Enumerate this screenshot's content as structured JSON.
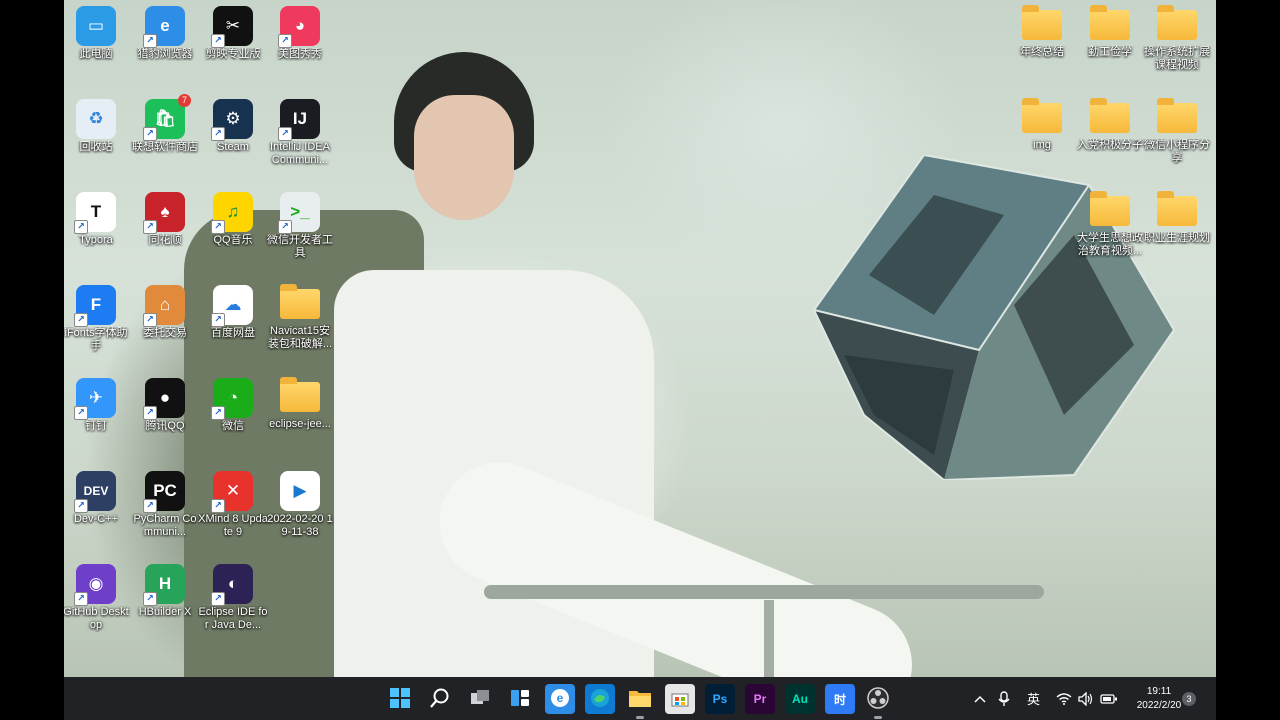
{
  "desktop": {
    "left_icons": [
      {
        "id": "this-pc",
        "label": "此电脑",
        "icon": "monitor-icon",
        "color": "#2b9be8",
        "shortcut": false
      },
      {
        "id": "browser",
        "label": "猎豹浏览器",
        "icon": "browser-icon",
        "color": "#2e8de6",
        "shortcut": true
      },
      {
        "id": "capcut",
        "label": "剪映专业版",
        "icon": "capcut-icon",
        "color": "#111111",
        "shortcut": true
      },
      {
        "id": "meitu",
        "label": "美图秀秀",
        "icon": "meitu-icon",
        "color": "#ef3a5d",
        "shortcut": true
      },
      {
        "id": "recycle-bin",
        "label": "回收站",
        "icon": "recycle-bin-icon",
        "color": "#e6eef5",
        "shortcut": false
      },
      {
        "id": "lenovo-store",
        "label": "联想软件商店",
        "icon": "shopping-bag-icon",
        "color": "#1dbf5a",
        "shortcut": true,
        "badge": "7"
      },
      {
        "id": "steam",
        "label": "Steam",
        "icon": "steam-icon",
        "color": "#16324f",
        "shortcut": true
      },
      {
        "id": "intellij",
        "label": "IntelliJ IDEA Communi...",
        "icon": "intellij-icon",
        "color": "#1b1b22",
        "shortcut": true
      },
      {
        "id": "typora",
        "label": "Typora",
        "icon": "typora-icon",
        "color": "#ffffff",
        "shortcut": true
      },
      {
        "id": "tonghuashun",
        "label": "同花顺",
        "icon": "cards-icon",
        "color": "#c8222a",
        "shortcut": true
      },
      {
        "id": "qq-music",
        "label": "QQ音乐",
        "icon": "music-icon",
        "color": "#ffd500",
        "shortcut": true
      },
      {
        "id": "wechat-devtools",
        "label": "微信开发者工具",
        "icon": "terminal-icon",
        "color": "#e8eef0",
        "shortcut": true
      },
      {
        "id": "ifonts",
        "label": "iFonts字体助手",
        "icon": "ifonts-icon",
        "color": "#1d7cf2",
        "shortcut": true
      },
      {
        "id": "weituo",
        "label": "委托交易",
        "icon": "house-icon",
        "color": "#e28a3b",
        "shortcut": true
      },
      {
        "id": "baidu-pan",
        "label": "百度网盘",
        "icon": "cloud-icon",
        "color": "#ffffff",
        "shortcut": true
      },
      {
        "id": "navicat",
        "label": "Navicat15安装包和破解...",
        "icon": "folder-icon",
        "color": "#f6b93b",
        "shortcut": false
      },
      {
        "id": "dingtalk",
        "label": "钉钉",
        "icon": "dingtalk-icon",
        "color": "#3296fa",
        "shortcut": true
      },
      {
        "id": "qq",
        "label": "腾讯QQ",
        "icon": "penguin-icon",
        "color": "#111111",
        "shortcut": true
      },
      {
        "id": "wechat",
        "label": "微信",
        "icon": "wechat-icon",
        "color": "#1aad19",
        "shortcut": true
      },
      {
        "id": "eclipse-folder",
        "label": "eclipse-jee...",
        "icon": "folder-icon",
        "color": "#f6b93b",
        "shortcut": false
      },
      {
        "id": "devcpp",
        "label": "Dev-C++",
        "icon": "dev-icon",
        "color": "#2d3f63",
        "shortcut": true
      },
      {
        "id": "pycharm",
        "label": "PyCharm Communi...",
        "icon": "pycharm-icon",
        "color": "#111111",
        "shortcut": true
      },
      {
        "id": "xmind",
        "label": "XMind 8 Update 9",
        "icon": "xmind-icon",
        "color": "#e8322c",
        "shortcut": true
      },
      {
        "id": "video-file",
        "label": "2022-02-20 19-11-38",
        "icon": "video-file-icon",
        "color": "#ffffff",
        "shortcut": false
      },
      {
        "id": "github-desktop",
        "label": "GitHub Desktop",
        "icon": "github-icon",
        "color": "#6e40c9",
        "shortcut": true
      },
      {
        "id": "hbuilder",
        "label": "HBuilder X",
        "icon": "hbuilder-icon",
        "color": "#27a35a",
        "shortcut": true
      },
      {
        "id": "eclipse",
        "label": "Eclipse IDE for Java De...",
        "icon": "eclipse-icon",
        "color": "#2c2255",
        "shortcut": true
      }
    ],
    "right_folders": [
      {
        "id": "annual-summary",
        "label": "年终总结"
      },
      {
        "id": "work-study",
        "label": "勤工俭学"
      },
      {
        "id": "os-course",
        "label": "操作系统扩展课程视频"
      },
      {
        "id": "img",
        "label": "img"
      },
      {
        "id": "party-member",
        "label": "入党积极分子"
      },
      {
        "id": "mini-program",
        "label": "微信小程序分享"
      },
      {
        "id": "ideology",
        "label": "大学生思想政治教育视频..."
      },
      {
        "id": "career",
        "label": "职业生涯规划"
      }
    ]
  },
  "taskbar": {
    "apps": [
      {
        "id": "start",
        "icon": "windows-icon",
        "label": ""
      },
      {
        "id": "search",
        "icon": "search-icon",
        "label": ""
      },
      {
        "id": "task-view",
        "icon": "task-view-icon",
        "label": ""
      },
      {
        "id": "widgets",
        "icon": "widgets-icon",
        "label": ""
      },
      {
        "id": "browser-tb",
        "icon": "browser-icon",
        "label": ""
      },
      {
        "id": "edge",
        "icon": "edge-icon",
        "label": ""
      },
      {
        "id": "explorer",
        "icon": "folder-icon",
        "label": ""
      },
      {
        "id": "store",
        "icon": "store-icon",
        "label": ""
      },
      {
        "id": "photoshop",
        "icon": "photoshop-icon",
        "label": "Ps"
      },
      {
        "id": "premiere",
        "icon": "premiere-icon",
        "label": "Pr"
      },
      {
        "id": "audition",
        "icon": "audition-icon",
        "label": "Au"
      },
      {
        "id": "shijian",
        "icon": "time-icon",
        "label": "时"
      },
      {
        "id": "obs",
        "icon": "obs-icon",
        "label": ""
      }
    ],
    "tray": {
      "ime": "英",
      "time": "19:11",
      "date": "2022/2/20",
      "notification_count": "3"
    }
  },
  "colors": {
    "taskbar": "#202225",
    "folder": "#f6b93b",
    "accent": "#3a8ee6"
  }
}
